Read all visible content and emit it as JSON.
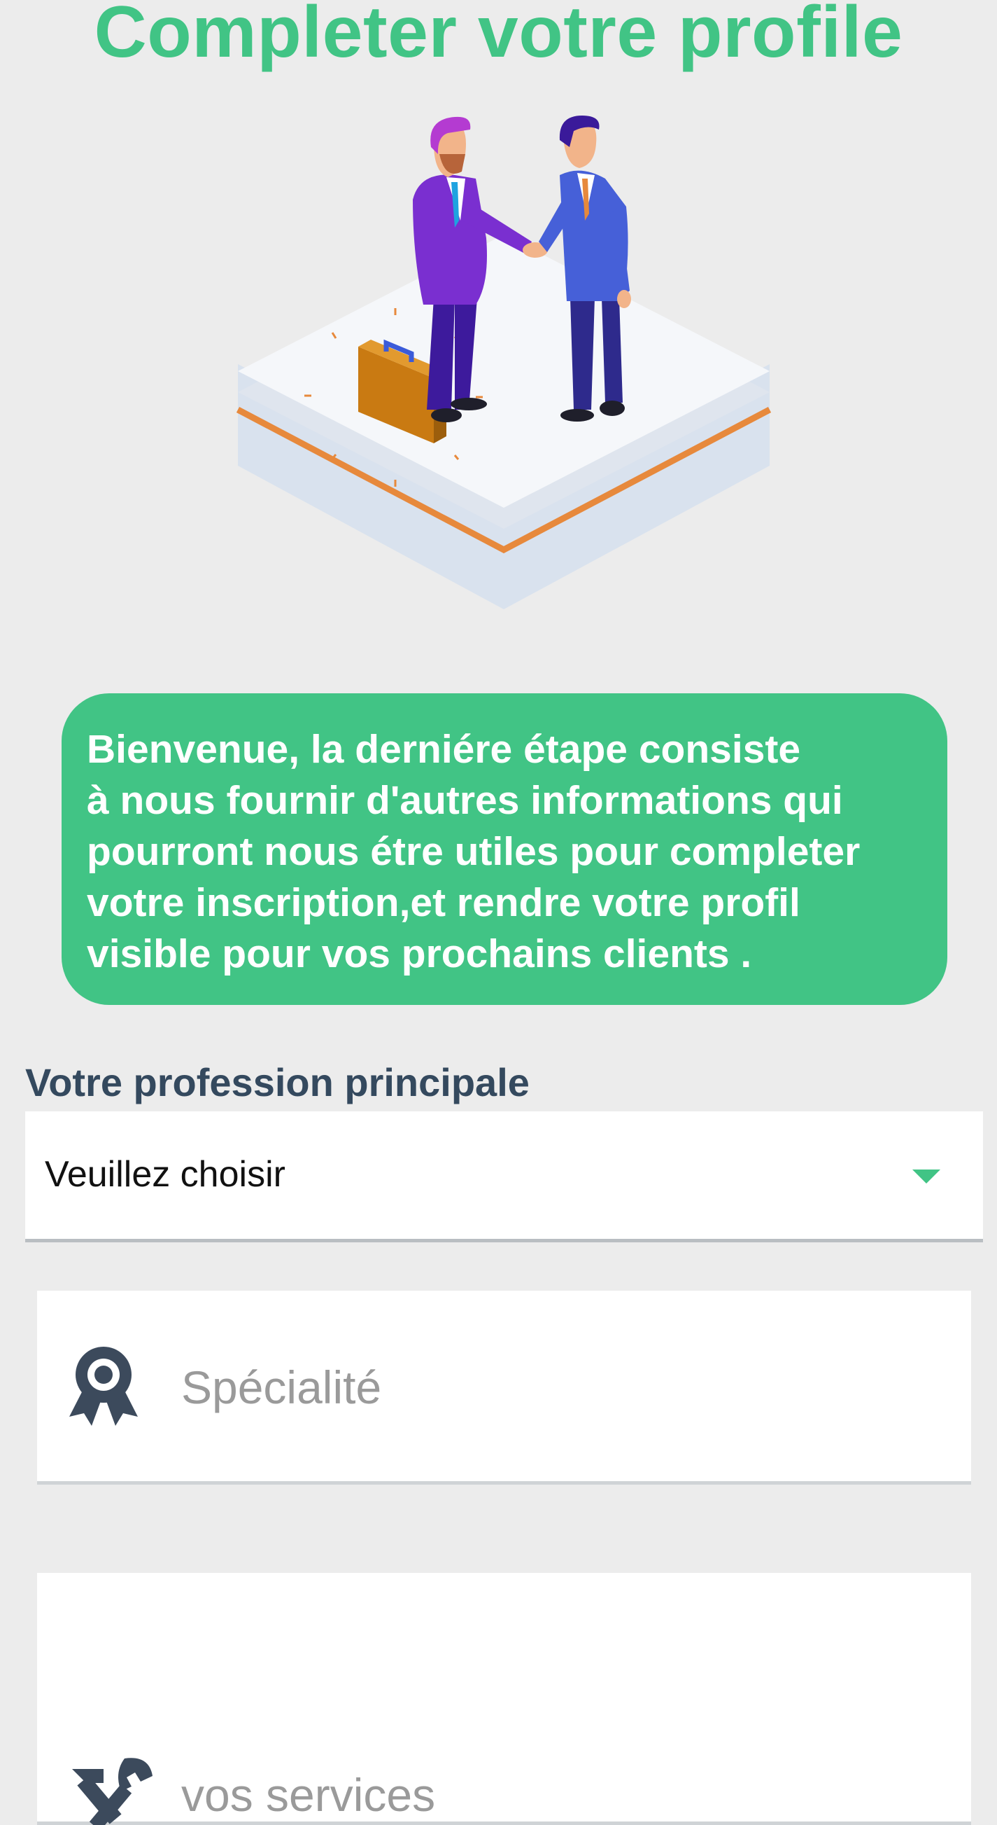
{
  "header": {
    "title": "Completer votre profile"
  },
  "illustration": {
    "name": "handshake-illustration"
  },
  "welcome": {
    "text": " Bienvenue, la derniére étape consiste\nà nous fournir d'autres informations qui\npourront nous étre utiles pour completer\nvotre inscription,et rendre votre profil\nvisible pour vos prochains clients ."
  },
  "profession": {
    "label": "Votre profession principale",
    "selected": "Veuillez choisir",
    "icon": "caret-down-icon"
  },
  "specialite": {
    "placeholder": "Spécialité",
    "icon": "award-ribbon-icon"
  },
  "services": {
    "placeholder": "vos services",
    "icon": "tools-icon"
  },
  "colors": {
    "accent": "#41c485",
    "label": "#34495e",
    "background": "#ececec",
    "placeholder": "#9a9a9a"
  }
}
